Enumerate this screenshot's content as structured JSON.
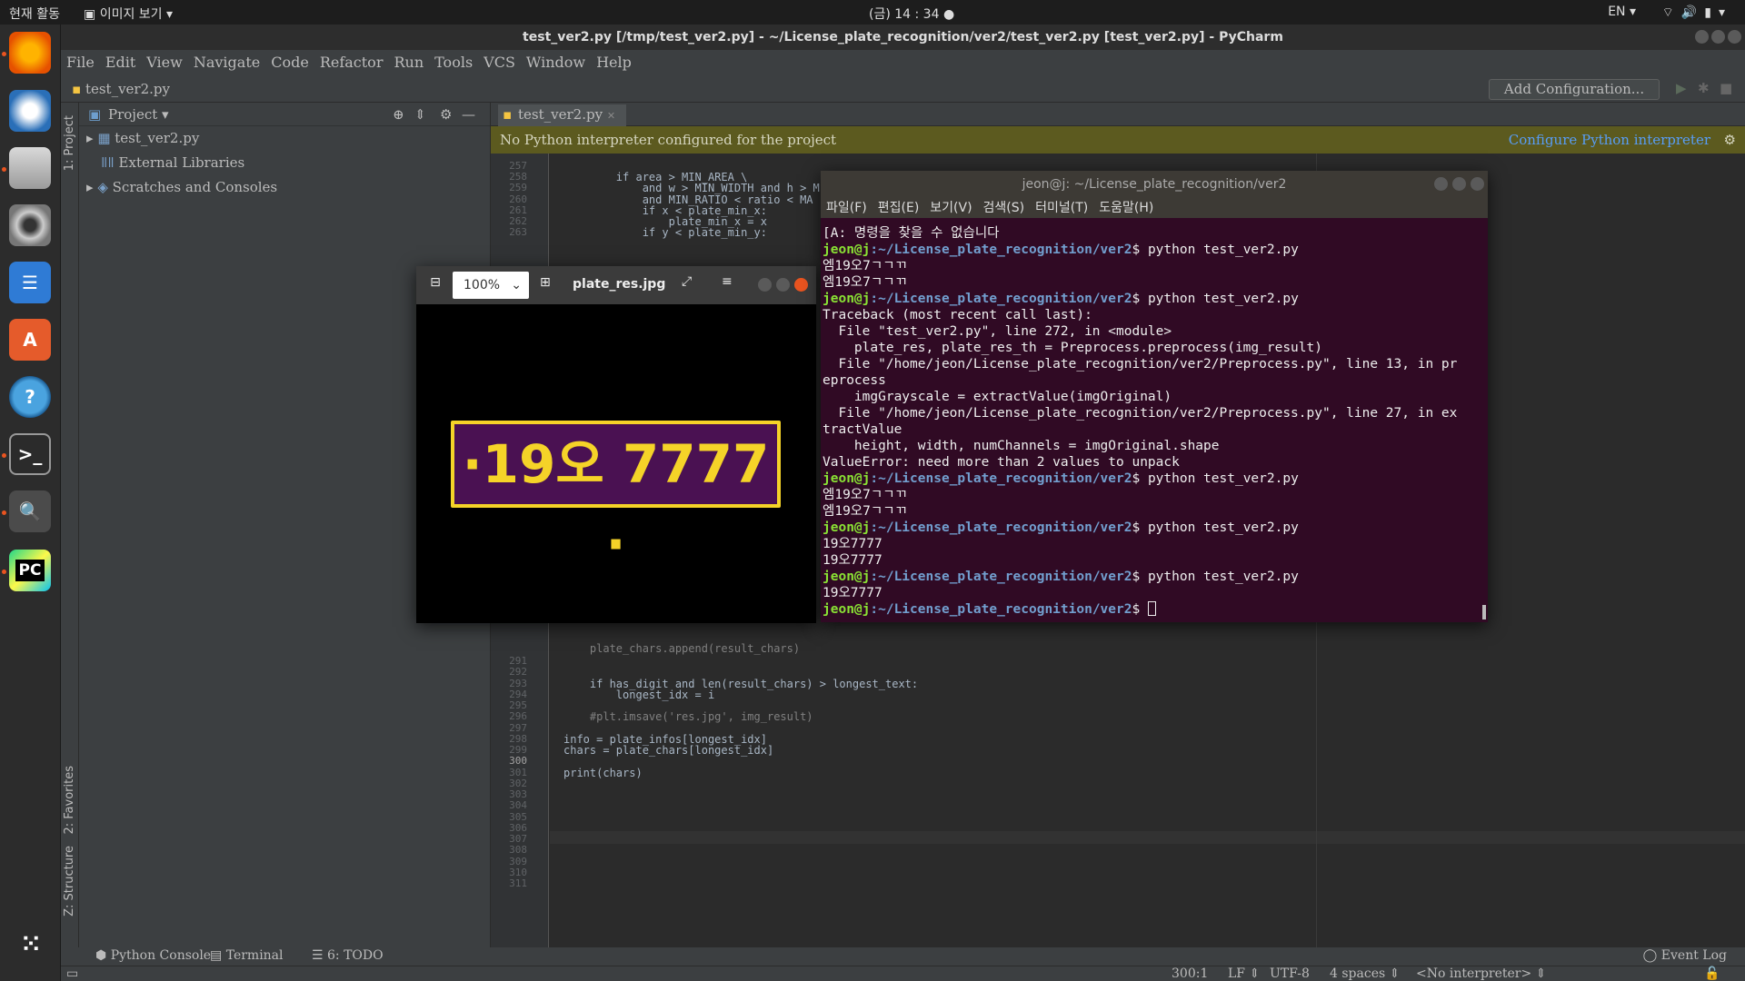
{
  "topbar": {
    "activities": "현재 활동",
    "viewer": "이미지 보기",
    "clock": "(금) 14 : 34",
    "lang": "EN"
  },
  "window": {
    "title": "test_ver2.py [/tmp/test_ver2.py] - ~/License_plate_recognition/ver2/test_ver2.py [test_ver2.py] - PyCharm"
  },
  "menu": [
    "File",
    "Edit",
    "View",
    "Navigate",
    "Code",
    "Refactor",
    "Run",
    "Tools",
    "VCS",
    "Window",
    "Help"
  ],
  "nav": {
    "file": "test_ver2.py",
    "add_config": "Add Configuration..."
  },
  "side_tabs": {
    "project": "1: Project",
    "favorites": "2: Favorites",
    "structure": "Z: Structure"
  },
  "project": {
    "header": "Project",
    "items": [
      "test_ver2.py",
      "External Libraries",
      "Scratches and Consoles"
    ]
  },
  "editor": {
    "tab": "test_ver2.py",
    "banner": "No Python interpreter configured for the project",
    "banner_link": "Configure Python interpreter",
    "top_lines": [
      "257",
      "258",
      "259",
      "260",
      "261",
      "262",
      "263"
    ],
    "bottom_lines": [
      "291",
      "292",
      "293",
      "294",
      "295",
      "296",
      "297",
      "298",
      "299",
      "300",
      "301",
      "302",
      "303",
      "304",
      "305",
      "306",
      "307",
      "308",
      "309",
      "310",
      "311"
    ],
    "code_top": [
      "",
      "        if area > MIN_AREA \\",
      "            and w > MIN_WIDTH and h > M",
      "            and MIN_RATIO < ratio < MA",
      "            if x < plate_min_x:",
      "                plate_min_x = x",
      "            if y < plate_min_y:"
    ],
    "code_append": "    plate_chars.append(result_chars)",
    "code_bottom": [
      "",
      "",
      "    if has_digit and len(result_chars) > longest_text:",
      "        longest_idx = i",
      "",
      "    #plt.imsave('res.jpg', img_result)",
      "",
      "info = plate_infos[longest_idx]",
      "chars = plate_chars[longest_idx]",
      "",
      "print(chars)",
      "",
      "",
      "",
      "",
      "",
      "",
      "",
      "",
      "",
      ""
    ]
  },
  "bottom_tabs": [
    "Python Console",
    "Terminal",
    "6: TODO"
  ],
  "event_log": "Event Log",
  "status": {
    "position": "300:1",
    "lf": "LF",
    "encoding": "UTF-8",
    "indent": "4 spaces",
    "interpreter": "<No interpreter>"
  },
  "image_viewer": {
    "zoom": "100%",
    "filename": "plate_res.jpg",
    "plate_text": "·19오 7777 ·"
  },
  "terminal": {
    "title": "jeon@j: ~/License_plate_recognition/ver2",
    "menu": [
      "파일(F)",
      "편집(E)",
      "보기(V)",
      "검색(S)",
      "터미널(T)",
      "도움말(H)"
    ],
    "prompt_user": "jeon@j",
    "prompt_path": ":~/License_plate_recognition/ver2",
    "lines": [
      {
        "type": "out",
        "text": "[A: 명령을 찾을 수 없습니다"
      },
      {
        "type": "cmd",
        "text": "$ python test_ver2.py"
      },
      {
        "type": "out",
        "text": "엠19오7ㄱㄱㄲ"
      },
      {
        "type": "out",
        "text": "엠19오7ㄱㄱㄲ"
      },
      {
        "type": "cmd",
        "text": "$ python test_ver2.py"
      },
      {
        "type": "out",
        "text": "Traceback (most recent call last):"
      },
      {
        "type": "out",
        "text": "  File \"test_ver2.py\", line 272, in <module>"
      },
      {
        "type": "out",
        "text": "    plate_res, plate_res_th = Preprocess.preprocess(img_result)"
      },
      {
        "type": "out",
        "text": "  File \"/home/jeon/License_plate_recognition/ver2/Preprocess.py\", line 13, in pr"
      },
      {
        "type": "out",
        "text": "eprocess"
      },
      {
        "type": "out",
        "text": "    imgGrayscale = extractValue(imgOriginal)"
      },
      {
        "type": "out",
        "text": "  File \"/home/jeon/License_plate_recognition/ver2/Preprocess.py\", line 27, in ex"
      },
      {
        "type": "out",
        "text": "tractValue"
      },
      {
        "type": "out",
        "text": "    height, width, numChannels = imgOriginal.shape"
      },
      {
        "type": "out",
        "text": "ValueError: need more than 2 values to unpack"
      },
      {
        "type": "cmd",
        "text": "$ python test_ver2.py"
      },
      {
        "type": "out",
        "text": "엠19오7ㄱㄱㄲ"
      },
      {
        "type": "out",
        "text": "엠19오7ㄱㄱㄲ"
      },
      {
        "type": "cmd",
        "text": "$ python test_ver2.py"
      },
      {
        "type": "out",
        "text": "19오7777"
      },
      {
        "type": "out",
        "text": "19오7777"
      },
      {
        "type": "cmd",
        "text": "$ python test_ver2.py"
      },
      {
        "type": "out",
        "text": "19오7777"
      },
      {
        "type": "cmd",
        "text": "$ "
      }
    ]
  }
}
